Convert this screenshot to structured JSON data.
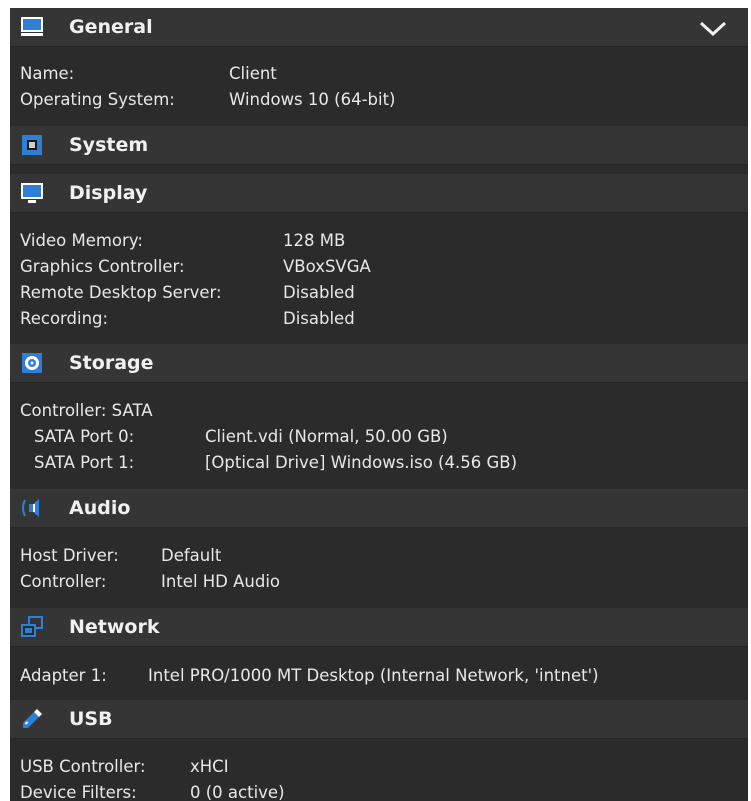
{
  "sections": {
    "general": {
      "title": "General",
      "icon": "monitor-icon",
      "rows": [
        {
          "label": "Name:",
          "value": "Client"
        },
        {
          "label": "Operating System:",
          "value": "Windows 10 (64-bit)"
        }
      ]
    },
    "system": {
      "title": "System",
      "icon": "chip-icon"
    },
    "display": {
      "title": "Display",
      "icon": "display-icon",
      "rows": [
        {
          "label": "Video Memory:",
          "value": "128 MB"
        },
        {
          "label": "Graphics Controller:",
          "value": "VBoxSVGA"
        },
        {
          "label": "Remote Desktop Server:",
          "value": "Disabled"
        },
        {
          "label": "Recording:",
          "value": "Disabled"
        }
      ]
    },
    "storage": {
      "title": "Storage",
      "icon": "storage-icon",
      "controller": "Controller: SATA",
      "rows": [
        {
          "label": "SATA Port 0:",
          "value": "Client.vdi (Normal, 50.00 GB)"
        },
        {
          "label": "SATA Port 1:",
          "value": "[Optical Drive] Windows.iso (4.56 GB)"
        }
      ]
    },
    "audio": {
      "title": "Audio",
      "icon": "speaker-icon",
      "rows": [
        {
          "label": "Host Driver:",
          "value": "Default"
        },
        {
          "label": "Controller:",
          "value": "Intel HD Audio"
        }
      ]
    },
    "network": {
      "title": "Network",
      "icon": "network-icon",
      "rows": [
        {
          "label": "Adapter 1:",
          "value": "Intel PRO/1000 MT Desktop (Internal Network, 'intnet')"
        }
      ]
    },
    "usb": {
      "title": "USB",
      "icon": "usb-icon",
      "rows": [
        {
          "label": "USB Controller:",
          "value": "xHCI"
        },
        {
          "label": "Device Filters:",
          "value": "0 (0 active)"
        }
      ]
    }
  },
  "colors": {
    "panel_background": "#2b2b2b",
    "header_background": "#353535",
    "text": "#e8e8e8",
    "icon_blue": "#2f7fd6"
  }
}
